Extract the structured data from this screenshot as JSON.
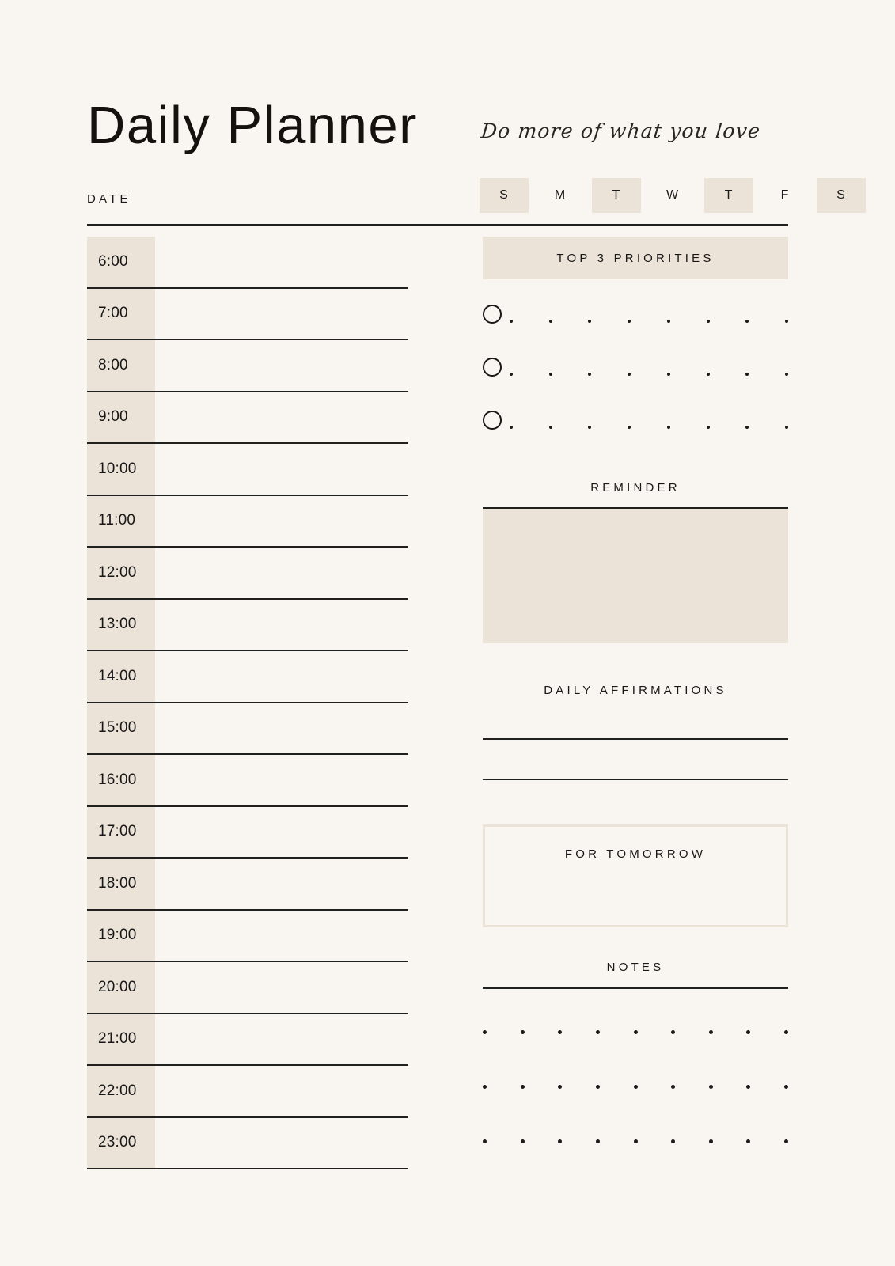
{
  "page": {
    "background_color": "#f9f6f1",
    "accent_color": "#ece3d8",
    "ink_color": "#1a1a1a"
  },
  "header": {
    "title": "Daily Planner",
    "tagline": "Do more of what you love",
    "date_label": "DATE",
    "days": [
      {
        "letter": "S",
        "highlighted": true
      },
      {
        "letter": "M",
        "highlighted": false
      },
      {
        "letter": "T",
        "highlighted": true
      },
      {
        "letter": "W",
        "highlighted": false
      },
      {
        "letter": "T",
        "highlighted": true
      },
      {
        "letter": "F",
        "highlighted": false
      },
      {
        "letter": "S",
        "highlighted": true
      }
    ]
  },
  "schedule": {
    "times": [
      "6:00",
      "7:00",
      "8:00",
      "9:00",
      "10:00",
      "11:00",
      "12:00",
      "13:00",
      "14:00",
      "15:00",
      "16:00",
      "17:00",
      "18:00",
      "19:00",
      "20:00",
      "21:00",
      "22:00",
      "23:00"
    ]
  },
  "priorities": {
    "heading": "TOP 3 PRIORITIES",
    "rows": 3,
    "dots_per_row": 8
  },
  "reminder": {
    "heading": "REMINDER"
  },
  "affirmations": {
    "heading": "DAILY AFFIRMATIONS",
    "lines": 2
  },
  "tomorrow": {
    "heading": "FOR TOMORROW"
  },
  "notes": {
    "heading": "NOTES",
    "rows": 3,
    "dots_per_row": 9
  }
}
